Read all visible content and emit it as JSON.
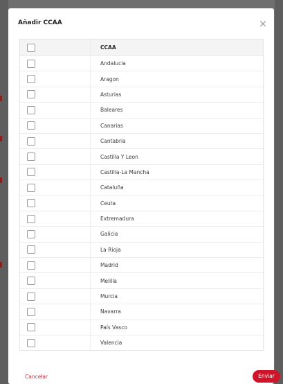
{
  "modal": {
    "title": "Añadir CCAA",
    "close_icon": "close-icon"
  },
  "table": {
    "column_header": "CCAA",
    "rows": [
      "Andalucia",
      "Aragon",
      "Asturias",
      "Baleares",
      "Canarias",
      "Cantabria",
      "Castilla Y Leon",
      "Castilla-La Mancha",
      "Cataluña",
      "Ceuta",
      "Extremadura",
      "Galicia",
      "La Rioja",
      "Madrid",
      "Melilla",
      "Murcia",
      "Navarra",
      "País Vasco",
      "Valencia"
    ]
  },
  "footer": {
    "cancel_label": "Cancelar",
    "submit_label": "Enviar"
  },
  "colors": {
    "accent": "#d0152b",
    "overlay": "#6f6f6f"
  }
}
